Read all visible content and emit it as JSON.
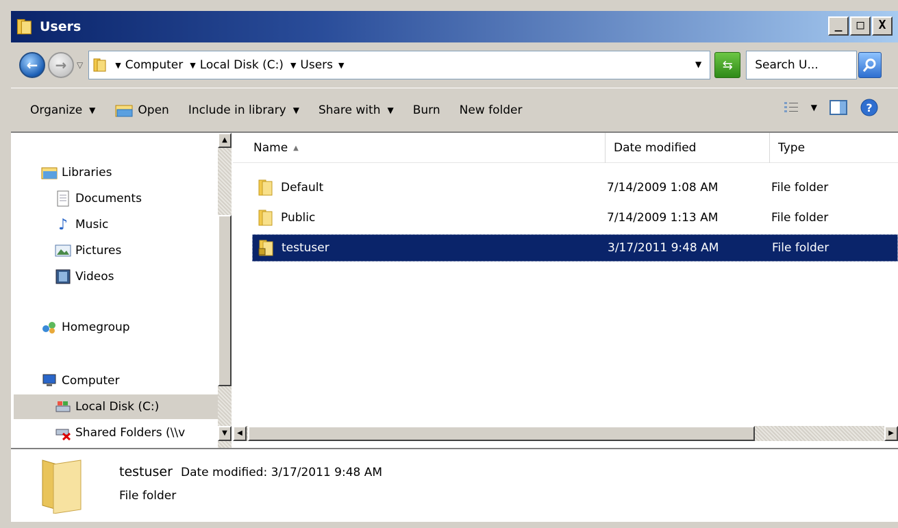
{
  "window": {
    "title": "Users",
    "min_glyph": "_",
    "max_glyph": "□",
    "close_glyph": "X"
  },
  "address": {
    "crumbs": [
      "Computer",
      "Local Disk (C:)",
      "Users"
    ],
    "search_placeholder": "Search U..."
  },
  "toolbar": {
    "organize": "Organize",
    "open": "Open",
    "include": "Include in library",
    "share": "Share with",
    "burn": "Burn",
    "new_folder": "New folder"
  },
  "nav": {
    "libraries": "Libraries",
    "documents": "Documents",
    "music": "Music",
    "pictures": "Pictures",
    "videos": "Videos",
    "homegroup": "Homegroup",
    "computer": "Computer",
    "local_disk": "Local Disk (C:)",
    "shared": "Shared Folders (\\\\v"
  },
  "columns": {
    "name": "Name",
    "date": "Date modified",
    "type": "Type"
  },
  "files": [
    {
      "name": "Default",
      "date": "7/14/2009 1:08 AM",
      "type": "File folder"
    },
    {
      "name": "Public",
      "date": "7/14/2009 1:13 AM",
      "type": "File folder"
    },
    {
      "name": "testuser",
      "date": "3/17/2011 9:48 AM",
      "type": "File folder"
    }
  ],
  "details": {
    "name": "testuser",
    "meta": "Date modified: 3/17/2011 9:48 AM",
    "type": "File folder"
  },
  "colors": {
    "selection": "#0a246a",
    "titlebar": "#0a246a",
    "chrome": "#d4d0c8"
  }
}
